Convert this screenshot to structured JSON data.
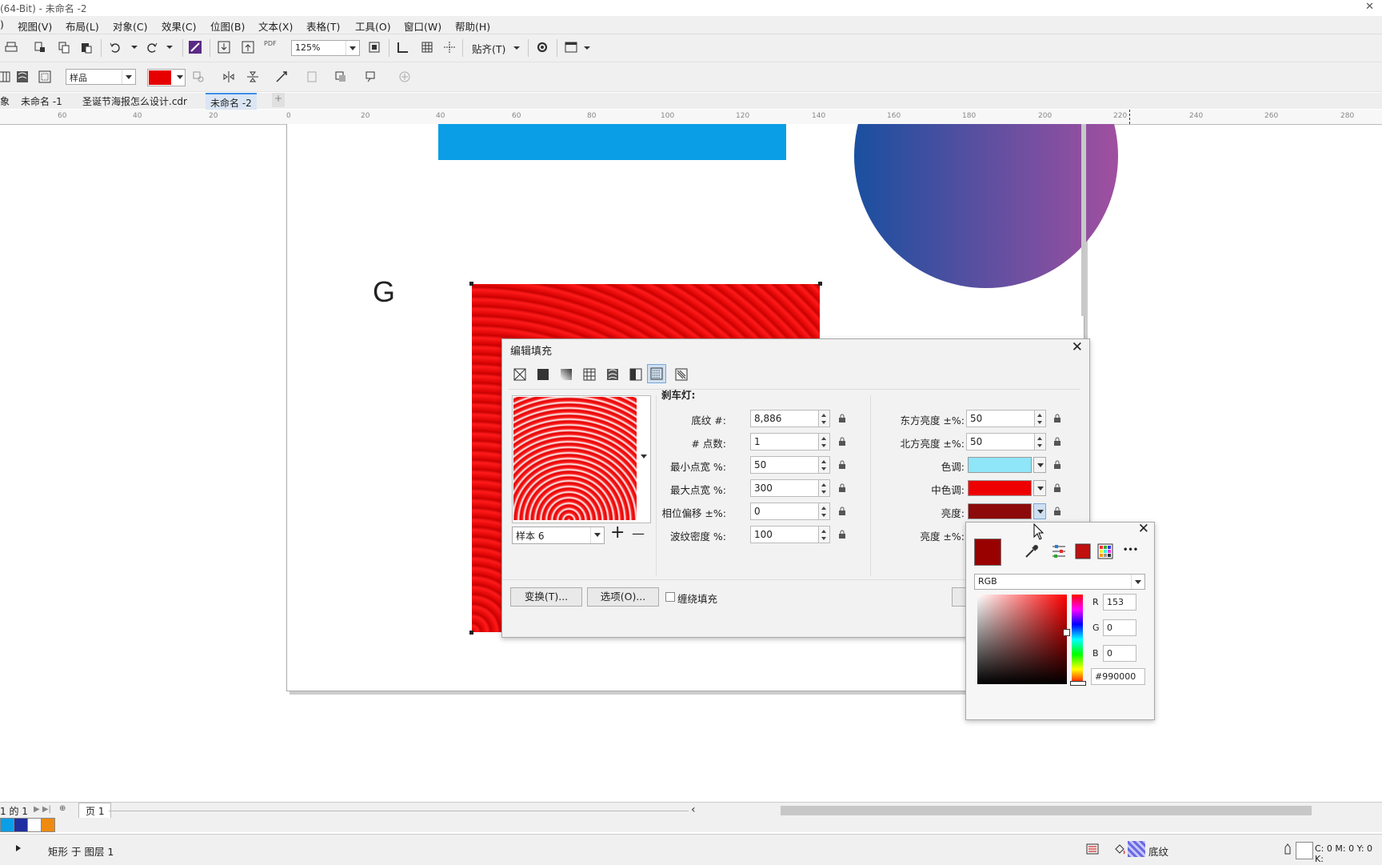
{
  "window": {
    "title": "(64-Bit) - 未命名 -2",
    "close_glyph": "✕"
  },
  "menu": [
    "视图(V)",
    "布局(L)",
    "对象(C)",
    "效果(C)",
    "位图(B)",
    "文本(X)",
    "表格(T)",
    "工具(O)",
    "窗口(W)",
    "帮助(H)"
  ],
  "toolbar": {
    "pdf_label": "PDF",
    "zoom": "125%",
    "snap_label": "贴齐(T)"
  },
  "propbar": {
    "style_combo": "样品",
    "fill_color": "#e60000"
  },
  "tabs": [
    "象",
    "未命名 -1",
    "圣诞节海报怎么设计.cdr",
    "未命名 -2"
  ],
  "ruler_ticks": [
    "60",
    "40",
    "20",
    "0",
    "20",
    "40",
    "60",
    "80",
    "100",
    "120",
    "140",
    "160",
    "180",
    "200",
    "220",
    "240",
    "260",
    "280"
  ],
  "canvas": {
    "letter": "G",
    "blue_rect_color": "#0a9ee6",
    "gradient_from": "#1a4fa0",
    "gradient_to": "#a14fa0"
  },
  "dialog": {
    "title": "编辑填充",
    "close_glyph": "✕",
    "section_title": "刹车灯:",
    "preset": "样本 6",
    "plus": "+",
    "minus": "—",
    "fields_left": [
      {
        "label": "底纹 #:",
        "value": "8,886"
      },
      {
        "label": "# 点数:",
        "value": "1"
      },
      {
        "label": "最小点宽 %:",
        "value": "50"
      },
      {
        "label": "最大点宽 %:",
        "value": "300"
      },
      {
        "label": "相位偏移 ±%:",
        "value": "0"
      },
      {
        "label": "波纹密度 %:",
        "value": "100"
      }
    ],
    "fields_right": [
      {
        "label": "东方亮度 ±%:",
        "value": "50"
      },
      {
        "label": "北方亮度 ±%:",
        "value": "50"
      }
    ],
    "colors_right": [
      {
        "label": "色调:",
        "color": "#8ee6f8"
      },
      {
        "label": "中色调:",
        "color": "#ee0000"
      },
      {
        "label": "亮度:",
        "color": "#8c0a0a"
      }
    ],
    "brightness_label": "亮度 ±%:",
    "transform_button": "变换(T)...",
    "options_button": "选项(O)...",
    "wrap_fill_label": "缠绕填充"
  },
  "color_popup": {
    "close_glyph": "✕",
    "model": "RGB",
    "current_color": "#990000",
    "more_glyph": "•••",
    "r_label": "R",
    "r": "153",
    "g_label": "G",
    "g": "0",
    "b_label": "B",
    "b": "0",
    "hex": "#990000"
  },
  "pagebar": {
    "page_count": "1 的 1",
    "page_tab": "页 1",
    "scroll_left": "‹"
  },
  "palette": [
    "#0a9ee6",
    "#1f2fa0",
    "#ffffff",
    "#ef8a10"
  ],
  "status": {
    "object": "矩形 于 图层 1",
    "fill_name": "底纹",
    "cmyk": "C: 0 M: 0 Y: 0 K:"
  }
}
